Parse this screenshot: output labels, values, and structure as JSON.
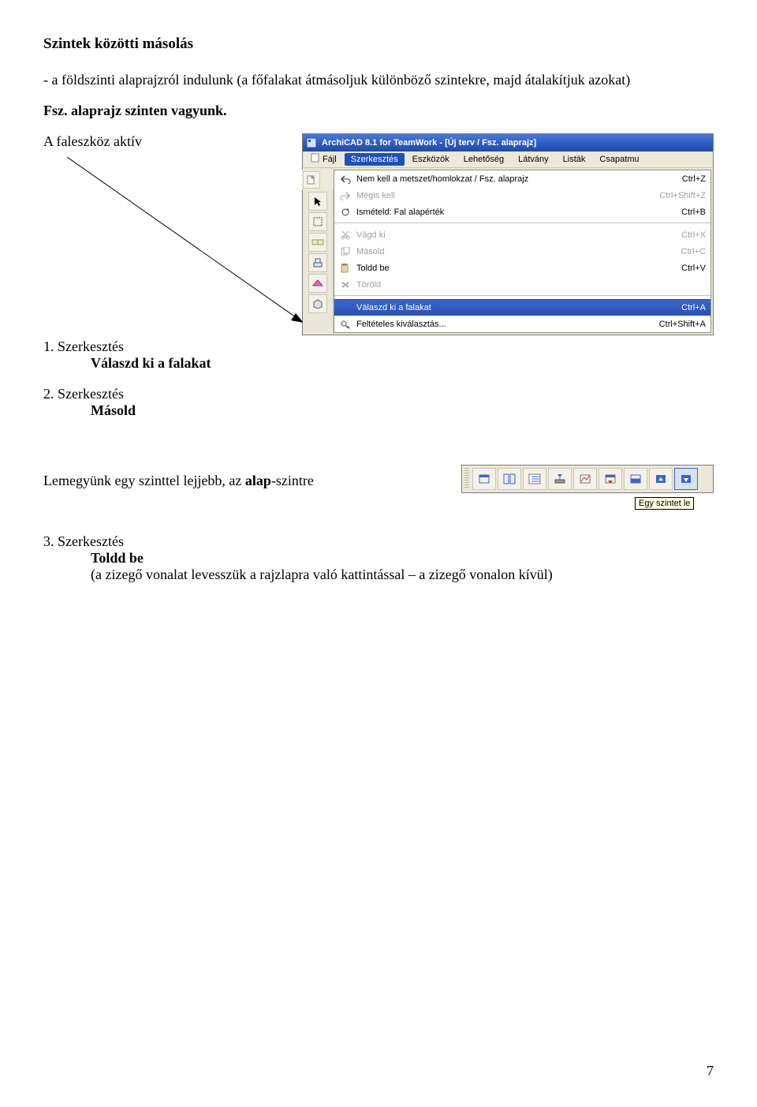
{
  "heading": "Szintek közötti másolás",
  "intro": "- a földszinti alaprajzról indulunk (a főfalakat átmásoljuk különböző szintekre, majd átalakítjuk azokat)",
  "line_fsz": "Fsz. alaprajz szinten vagyunk.",
  "line_faleszkoz": "A faleszköz aktív",
  "steps": {
    "s1": {
      "head": "1. Szerkesztés",
      "sub": "Válaszd ki a falakat"
    },
    "s2": {
      "head": "2. Szerkesztés",
      "sub": "Másold"
    },
    "s3": {
      "head": "3. Szerkesztés",
      "sub": "Toldd be"
    }
  },
  "lower_line_pre": "Lemegyünk egy szinttel lejjebb, az ",
  "lower_line_bold": "alap",
  "lower_line_post": "-szintre",
  "step3_note": "(a zizegő vonalat levesszük a rajzlapra való kattintással – a zizegő vonalon kívül)",
  "archicad": {
    "title": "ArchiCAD 8.1 for TeamWork - [Új terv / Fsz. alaprajz]",
    "menus": {
      "fajl": "Fájl",
      "szerkesztes": "Szerkesztés",
      "eszkozok": "Eszközök",
      "lehetoseg": "Lehetőség",
      "latvany": "Látvány",
      "listak": "Listák",
      "csapat": "Csapatmu"
    },
    "items": {
      "undo": {
        "label": "Nem kell a metszet/homlokzat / Fsz. alaprajz",
        "sc": "Ctrl+Z"
      },
      "redo": {
        "label": "Mégis kell",
        "sc": "Ctrl+Shift+Z"
      },
      "repeat": {
        "label": "Ismételd: Fal alapérték",
        "sc": "Ctrl+B"
      },
      "cut": {
        "label": "Vágd ki",
        "sc": "Ctrl+X"
      },
      "copy": {
        "label": "Másold",
        "sc": "Ctrl+C"
      },
      "paste": {
        "label": "Toldd be",
        "sc": "Ctrl+V"
      },
      "delete": {
        "label": "Töröld"
      },
      "selall": {
        "label": "Válaszd ki a falakat",
        "sc": "Ctrl+A"
      },
      "cond": {
        "label": "Feltételes kiválasztás...",
        "sc": "Ctrl+Shift+A"
      }
    }
  },
  "minitool": {
    "tooltip": "Egy szintet le"
  },
  "page_number": "7"
}
